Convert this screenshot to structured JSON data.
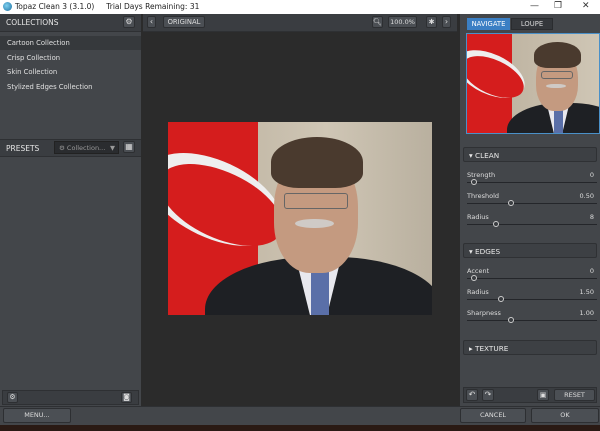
{
  "window": {
    "title": "Topaz Clean 3 (3.1.0)",
    "trial": "Trial Days Remaining: 31",
    "controls": [
      "—",
      "❐",
      "✕"
    ]
  },
  "collections": {
    "header": "COLLECTIONS",
    "items": [
      "Cartoon Collection",
      "Crisp Collection",
      "Skin Collection",
      "Stylized Edges Collection"
    ],
    "selected": 0
  },
  "presets": {
    "header": "PRESETS",
    "dropdown": "Collection..."
  },
  "toolbar": {
    "original": "ORIGINAL",
    "zoom": "100.0%"
  },
  "nav": {
    "tabs": [
      "NAVIGATE",
      "LOUPE"
    ],
    "active": 0
  },
  "clean": {
    "header": "CLEAN",
    "sliders": [
      {
        "label": "Strength",
        "value": "0",
        "fraction": 0.05
      },
      {
        "label": "Threshold",
        "value": "0.50",
        "fraction": 0.34
      },
      {
        "label": "Radius",
        "value": "8",
        "fraction": 0.22
      }
    ]
  },
  "edges": {
    "header": "EDGES",
    "sliders": [
      {
        "label": "Accent",
        "value": "0",
        "fraction": 0.05
      },
      {
        "label": "Radius",
        "value": "1.50",
        "fraction": 0.26
      },
      {
        "label": "Sharpness",
        "value": "1.00",
        "fraction": 0.34
      }
    ]
  },
  "texture": {
    "header": "TEXTURE"
  },
  "buttons": {
    "reset": "RESET",
    "menu": "MENU...",
    "cancel": "CANCEL",
    "ok": "OK"
  },
  "colors": {
    "accent": "#3b7fc4",
    "panel": "#43464a",
    "canvas": "#2b2b2b"
  }
}
